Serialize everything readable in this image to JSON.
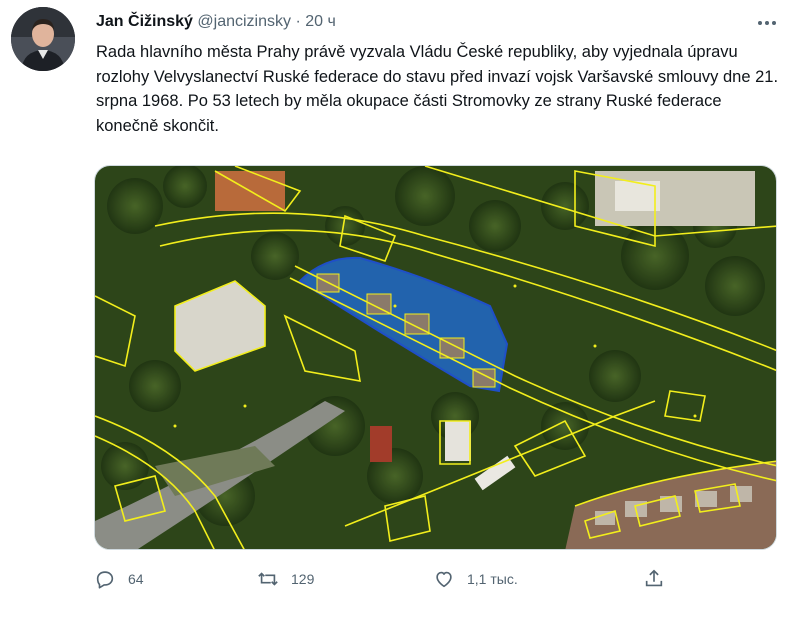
{
  "tweet": {
    "author_name": "Jan Čižinský",
    "author_handle": "@jancizinsky",
    "separator": "·",
    "time": "20 ч",
    "text": "Rada hlavního města Prahy právě vyzvala Vládu České republiky, aby vyjednala úpravu rozlohy Velvyslanectví Ruské federace do stavu před invazí vojsk Varšavské smlouvy dne 21. srpna 1968. Po 53 letech by měla okupace části Stromovky ze strany Ruské federace konečně skončit."
  },
  "actions": {
    "replies": "64",
    "retweets": "129",
    "likes": "1,1 тыс."
  },
  "icons": {
    "more": "more-icon",
    "reply": "reply-icon",
    "retweet": "retweet-icon",
    "like": "like-icon",
    "share": "share-icon"
  },
  "colors": {
    "text": "#0f1419",
    "secondary": "#536471",
    "parcel_outline": "#f2ee1c",
    "highlight_fill": "#1e6fe6"
  }
}
